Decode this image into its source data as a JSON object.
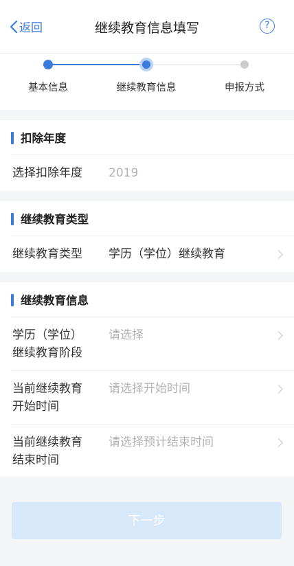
{
  "nav": {
    "back_label": "返回",
    "title": "继续教育信息填写",
    "help_glyph": "?"
  },
  "stepper": {
    "steps": [
      {
        "label": "基本信息",
        "state": "done"
      },
      {
        "label": "继续教育信息",
        "state": "current"
      },
      {
        "label": "申报方式",
        "state": "todo"
      }
    ],
    "colors": {
      "active": "#3a7be0",
      "inactive": "#cccccc"
    }
  },
  "sections": {
    "deduction_year": {
      "title": "扣除年度",
      "row": {
        "label": "选择扣除年度",
        "value": "2019"
      }
    },
    "education_type": {
      "title": "继续教育类型",
      "row": {
        "label": "继续教育类型",
        "value": "学历（学位）继续教育"
      }
    },
    "education_info": {
      "title": "继续教育信息",
      "rows": [
        {
          "label_line1": "学历（学位）",
          "label_line2": "继续教育阶段",
          "placeholder": "请选择"
        },
        {
          "label_line1": "当前继续教育",
          "label_line2": "开始时间",
          "placeholder": "请选择开始时间"
        },
        {
          "label_line1": "当前继续教育",
          "label_line2": "结束时间",
          "placeholder": "请选择预计结束时间"
        }
      ]
    }
  },
  "footer": {
    "next_label": "下一步"
  }
}
